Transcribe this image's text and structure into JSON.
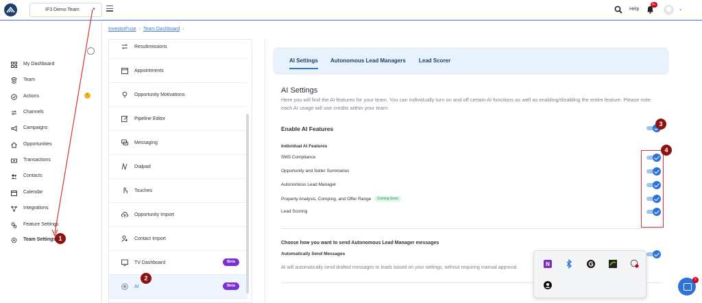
{
  "header": {
    "team_name": "IF3 Demo Team",
    "help_label": "Help",
    "notifications_count": "9+"
  },
  "sidebar": {
    "items": [
      {
        "label": "My Dashboard",
        "icon": "dashboard-icon"
      },
      {
        "label": "Team",
        "icon": "stack-icon"
      },
      {
        "label": "Actions",
        "icon": "check-circle-icon"
      },
      {
        "label": "Channels",
        "icon": "arrows-icon"
      },
      {
        "label": "Campaigns",
        "icon": "megaphone-icon"
      },
      {
        "label": "Opportunities",
        "icon": "home-icon"
      },
      {
        "label": "Transactions",
        "icon": "money-icon"
      },
      {
        "label": "Contacts",
        "icon": "users-icon"
      },
      {
        "label": "Calendar",
        "icon": "calendar-icon"
      },
      {
        "label": "Integrations",
        "icon": "nodes-icon"
      },
      {
        "label": "Feature Settings",
        "icon": "sliders-icon"
      },
      {
        "label": "Team Settings",
        "icon": "gear-icon"
      }
    ],
    "actions_badge": "!"
  },
  "breadcrumb": {
    "root": "InvestorFuse",
    "current": "Team Dashboard"
  },
  "settings_menu": {
    "items": [
      {
        "label": "Resubmissions",
        "icon": "resubmit-icon"
      },
      {
        "label": "Appointments",
        "icon": "calendar-icon"
      },
      {
        "label": "Opportunity Motivations",
        "icon": "lightbulb-icon"
      },
      {
        "label": "Pipeline Editor",
        "icon": "edit-icon"
      },
      {
        "label": "Messaging",
        "icon": "chat-icon"
      },
      {
        "label": "Dialpad",
        "icon": "dialpad-icon"
      },
      {
        "label": "Touches",
        "icon": "touch-icon"
      },
      {
        "label": "Opportunity Import",
        "icon": "cloud-upload-icon"
      },
      {
        "label": "Contact Import",
        "icon": "contact-add-icon"
      },
      {
        "label": "TV Dashboard",
        "icon": "tv-icon",
        "badge": "Beta"
      },
      {
        "label": "AI",
        "icon": "ai-chip-icon",
        "badge": "Beta"
      }
    ]
  },
  "tabs": [
    {
      "label": "AI Settings"
    },
    {
      "label": "Autonomous Lead Managers"
    },
    {
      "label": "Lead Scorer"
    }
  ],
  "ai_settings": {
    "title": "AI Settings",
    "description": "Here you will find the AI features for your team. You can individually turn on and off certain AI functions as well as enabling/disabling the entire feature. Please note each AI usage will use credits within your team.",
    "enable_label": "Enable AI Features",
    "enable_on": true,
    "individual_title": "Individual AI Features",
    "features": [
      {
        "label": "SMS Compliance",
        "on": true
      },
      {
        "label": "Opportunity and Seller Summaries",
        "on": true
      },
      {
        "label": "Autonomous Lead Manager",
        "on": true
      },
      {
        "label": "Property Analysis, Comping, and Offer Range",
        "on": true,
        "tag": "Coming Soon"
      },
      {
        "label": "Lead Scoring",
        "on": true
      }
    ],
    "choose_title": "Choose how you want to send Autonomous Lead Manager messages",
    "auto_send_label": "Automatically Send Messages",
    "auto_send_on": true,
    "auto_send_desc": "AI will automatically send drafted messages to leads based on your settings, without requiring manual approval."
  },
  "callouts": [
    "1",
    "2",
    "3",
    "4"
  ],
  "chat_badge": "2",
  "colors": {
    "accent": "#2d72d9",
    "callout": "#8e1212",
    "beta": "#7b2fd6"
  }
}
